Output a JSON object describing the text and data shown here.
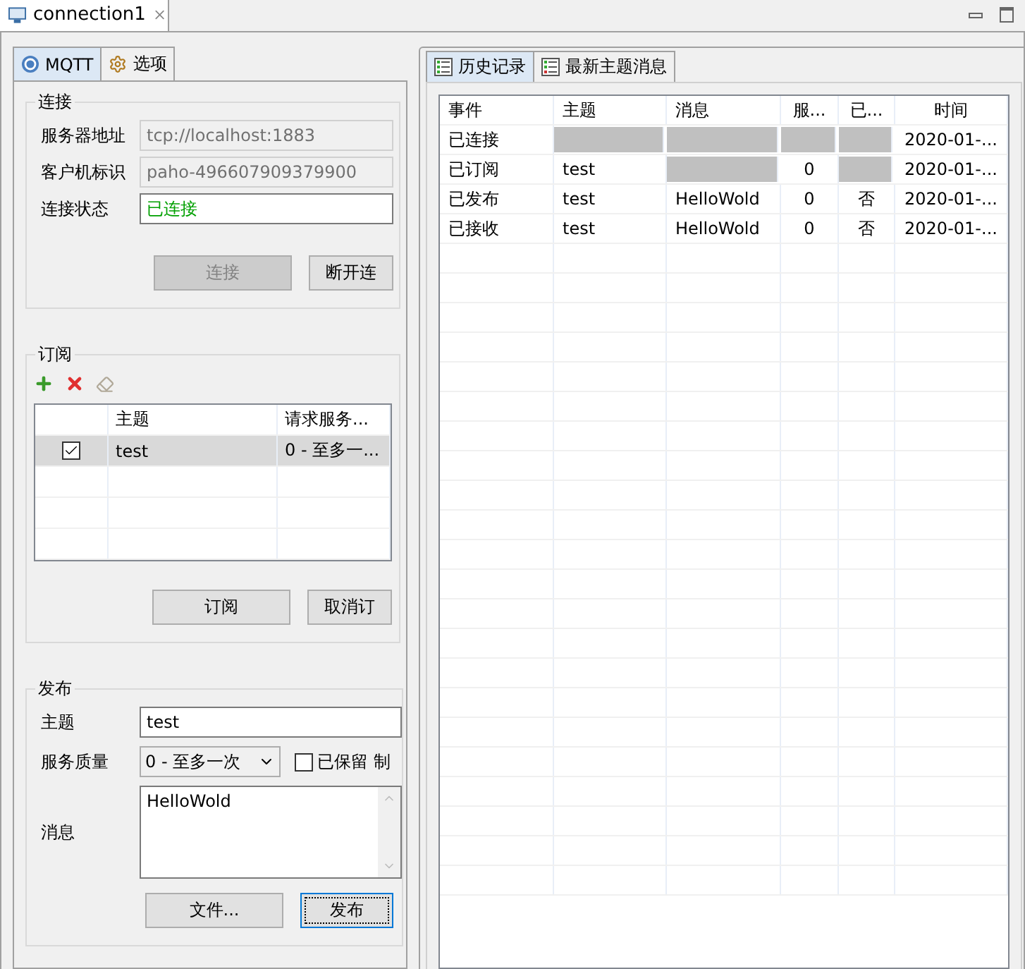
{
  "editor_tab": {
    "title": "connection1"
  },
  "tabs": [
    {
      "label": "MQTT",
      "selected": true
    },
    {
      "label": "选项",
      "selected": false
    }
  ],
  "connection": {
    "title": "连接",
    "fields": [
      {
        "label": "服务器地址",
        "value": "tcp://localhost:1883",
        "kind": "readonly"
      },
      {
        "label": "客户机标识",
        "value": "paho-496607909379900",
        "kind": "readonly"
      },
      {
        "label": "连接状态",
        "value": "已连接",
        "kind": "status"
      }
    ],
    "buttons": [
      {
        "label": "连接",
        "disabled": true
      },
      {
        "label": "断开连",
        "disabled": false
      }
    ]
  },
  "subscriptions": {
    "title": "订阅",
    "columns": [
      "主题",
      "请求服务..."
    ],
    "rows": [
      {
        "checked": true,
        "selected": true,
        "topic": "test",
        "qos": "0 - 至多一..."
      }
    ],
    "buttons": [
      {
        "label": "订阅"
      },
      {
        "label": "取消订"
      }
    ]
  },
  "publish": {
    "title": "发布",
    "topic_label": "主题",
    "topic": "test",
    "qos_label": "服务质量",
    "qos": "0 - 至多一次",
    "retained": {
      "label": "已保留",
      "checked": false
    },
    "trailing_text": "制",
    "message_label": "消息",
    "message": "HelloWold",
    "buttons": [
      {
        "label": "文件...",
        "focused": false
      },
      {
        "label": "发布",
        "focused": true
      }
    ]
  },
  "history": {
    "tabs": [
      {
        "label": "历史记录",
        "selected": true
      },
      {
        "label": "最新主题消息",
        "selected": false
      }
    ],
    "columns": [
      "事件",
      "主题",
      "消息",
      "服...",
      "已...",
      "时间"
    ],
    "rows": [
      {
        "cells": [
          {
            "kind": "text",
            "text": "已连接"
          },
          {
            "kind": "blank"
          },
          {
            "kind": "blank"
          },
          {
            "kind": "blank"
          },
          {
            "kind": "blank"
          },
          {
            "kind": "text",
            "text": "2020-01-..."
          }
        ]
      },
      {
        "cells": [
          {
            "kind": "text",
            "text": "已订阅"
          },
          {
            "kind": "text",
            "text": "test"
          },
          {
            "kind": "blank"
          },
          {
            "kind": "text",
            "text": "0"
          },
          {
            "kind": "blank"
          },
          {
            "kind": "text",
            "text": "2020-01-..."
          }
        ]
      },
      {
        "cells": [
          {
            "kind": "text",
            "text": "已发布"
          },
          {
            "kind": "text",
            "text": "test"
          },
          {
            "kind": "text",
            "text": "HelloWold"
          },
          {
            "kind": "text",
            "text": "0"
          },
          {
            "kind": "text",
            "text": "否"
          },
          {
            "kind": "text",
            "text": "2020-01-..."
          }
        ]
      },
      {
        "cells": [
          {
            "kind": "text",
            "text": "已接收"
          },
          {
            "kind": "text",
            "text": "test"
          },
          {
            "kind": "text",
            "text": "HelloWold"
          },
          {
            "kind": "text",
            "text": "0"
          },
          {
            "kind": "text",
            "text": "否"
          },
          {
            "kind": "text",
            "text": "2020-01-..."
          }
        ]
      }
    ]
  }
}
